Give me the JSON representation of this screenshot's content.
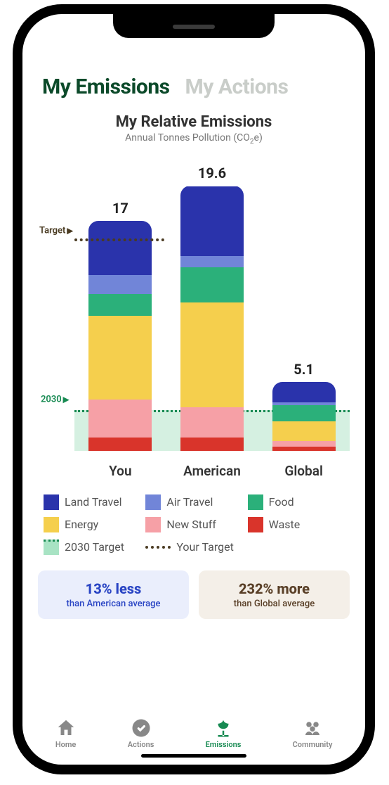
{
  "tabs": {
    "emissions": "My Emissions",
    "actions": "My Actions"
  },
  "chart_title": {
    "title": "My Relative Emissions",
    "subtitle_a": "Annual Tonnes Pollution (CO",
    "subtitle_b": "2",
    "subtitle_c": "e)"
  },
  "chart_data": {
    "type": "bar",
    "stacked": true,
    "ylabel": "Annual Tonnes Pollution (CO2e)",
    "ylim": [
      0,
      20
    ],
    "categories": [
      "You",
      "American",
      "Global"
    ],
    "totals": [
      17,
      19.6,
      5.1
    ],
    "series": [
      {
        "name": "Waste",
        "color": "#d9342b",
        "values": [
          1.0,
          1.0,
          0.3
        ]
      },
      {
        "name": "New Stuff",
        "color": "#f6a0a6",
        "values": [
          2.8,
          2.2,
          0.4
        ]
      },
      {
        "name": "Energy",
        "color": "#f5cf4d",
        "values": [
          6.2,
          7.8,
          1.5
        ]
      },
      {
        "name": "Food",
        "color": "#2bb07a",
        "values": [
          1.6,
          2.6,
          1.2
        ]
      },
      {
        "name": "Air Travel",
        "color": "#7185d8",
        "values": [
          1.4,
          0.8,
          0.2
        ]
      },
      {
        "name": "Land Travel",
        "color": "#2a33ab",
        "values": [
          4.0,
          5.2,
          1.5
        ]
      }
    ],
    "reference_lines": {
      "target_2030": {
        "label": "2030",
        "value": 3.0
      },
      "your_target": {
        "label": "Target",
        "value": 15.5
      }
    }
  },
  "legend": {
    "land_travel": "Land Travel",
    "air_travel": "Air Travel",
    "food": "Food",
    "energy": "Energy",
    "new_stuff": "New Stuff",
    "waste": "Waste",
    "target_2030": "2030 Target",
    "your_target": "Your Target"
  },
  "stats": {
    "american": {
      "headline": "13% less",
      "sub": "than American average"
    },
    "global": {
      "headline": "232% more",
      "sub": "than Global average"
    }
  },
  "nav": {
    "home": "Home",
    "actions": "Actions",
    "emissions": "Emissions",
    "community": "Community"
  }
}
